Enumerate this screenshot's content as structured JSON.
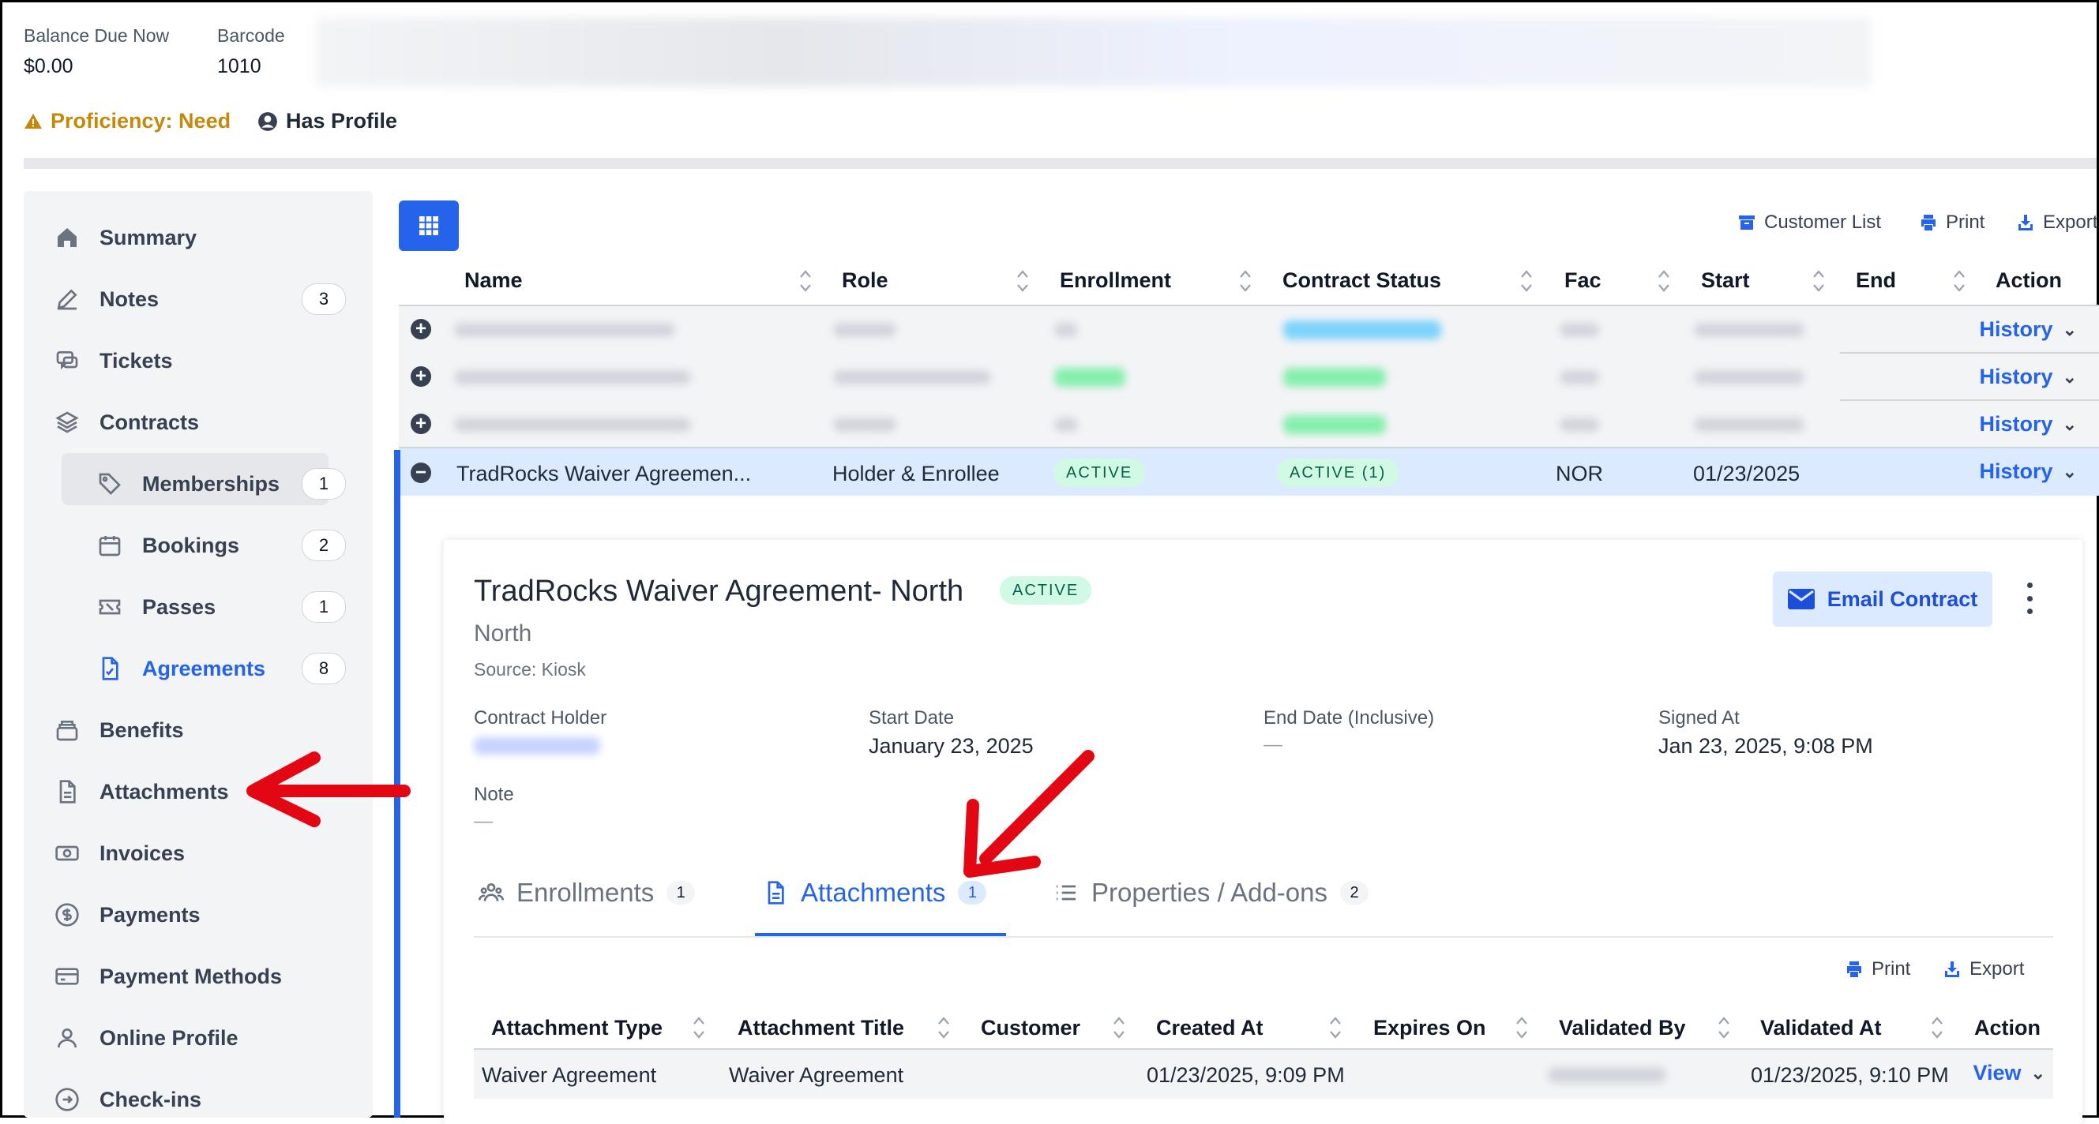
{
  "top": {
    "balance_label": "Balance Due Now",
    "balance_value": "$0.00",
    "barcode_label": "Barcode",
    "barcode_value": "1010",
    "proficiency": "Proficiency: Need",
    "has_profile": "Has Profile"
  },
  "sidebar": {
    "items": [
      {
        "label": "Summary",
        "icon": "home-icon"
      },
      {
        "label": "Notes",
        "icon": "pencil-icon",
        "count": "3"
      },
      {
        "label": "Tickets",
        "icon": "chat-icon"
      },
      {
        "label": "Contracts",
        "icon": "layers-icon"
      },
      {
        "label": "Memberships",
        "icon": "tag-icon",
        "count": "1"
      },
      {
        "label": "Bookings",
        "icon": "calendar-icon",
        "count": "2"
      },
      {
        "label": "Passes",
        "icon": "ticket-icon",
        "count": "1"
      },
      {
        "label": "Agreements",
        "icon": "document-check-icon",
        "count": "8"
      },
      {
        "label": "Benefits",
        "icon": "stack-icon"
      },
      {
        "label": "Attachments",
        "icon": "file-icon"
      },
      {
        "label": "Invoices",
        "icon": "cash-icon"
      },
      {
        "label": "Payments",
        "icon": "dollar-circle-icon"
      },
      {
        "label": "Payment Methods",
        "icon": "credit-card-icon"
      },
      {
        "label": "Online Profile",
        "icon": "user-icon"
      },
      {
        "label": "Check-ins",
        "icon": "arrow-circle-icon"
      }
    ]
  },
  "toolbar": {
    "customer_list": "Customer List",
    "print": "Print",
    "export": "Export"
  },
  "table": {
    "headers": [
      "Name",
      "Role",
      "Enrollment",
      "Contract Status",
      "Fac",
      "Start",
      "End",
      "Action"
    ],
    "action_label": "History",
    "selected_row": {
      "name": "TradRocks Waiver Agreemen...",
      "role": "Holder & Enrollee",
      "enrollment": "ACTIVE",
      "contract_status": "ACTIVE (1)",
      "fac": "NOR",
      "start": "01/23/2025"
    }
  },
  "detail": {
    "title": "TradRocks Waiver Agreement- North",
    "status": "ACTIVE",
    "subtitle": "North",
    "source": "Source: Kiosk",
    "email_button": "Email Contract",
    "fields": {
      "holder_label": "Contract Holder",
      "start_label": "Start Date",
      "start_value": "January 23, 2025",
      "end_label": "End Date (Inclusive)",
      "end_value": "—",
      "signed_label": "Signed At",
      "signed_value": "Jan 23, 2025, 9:08 PM",
      "note_label": "Note",
      "note_value": "—"
    },
    "tabs": [
      {
        "label": "Enrollments",
        "count": "1"
      },
      {
        "label": "Attachments",
        "count": "1"
      },
      {
        "label": "Properties / Add-ons",
        "count": "2"
      }
    ],
    "sub_toolbar": {
      "print": "Print",
      "export": "Export"
    },
    "attachments": {
      "headers": [
        "Attachment Type",
        "Attachment Title",
        "Customer",
        "Created At",
        "Expires On",
        "Validated By",
        "Validated At",
        "Action"
      ],
      "row": {
        "type": "Waiver Agreement",
        "title": "Waiver Agreement",
        "created_at": "01/23/2025, 9:09 PM",
        "validated_at": "01/23/2025, 9:10 PM",
        "action": "View"
      }
    }
  },
  "colors": {
    "accent": "#2563eb",
    "warning": "#c4880a",
    "active_badge_bg": "#d1fae5",
    "annotation_arrow": "#e30613"
  }
}
